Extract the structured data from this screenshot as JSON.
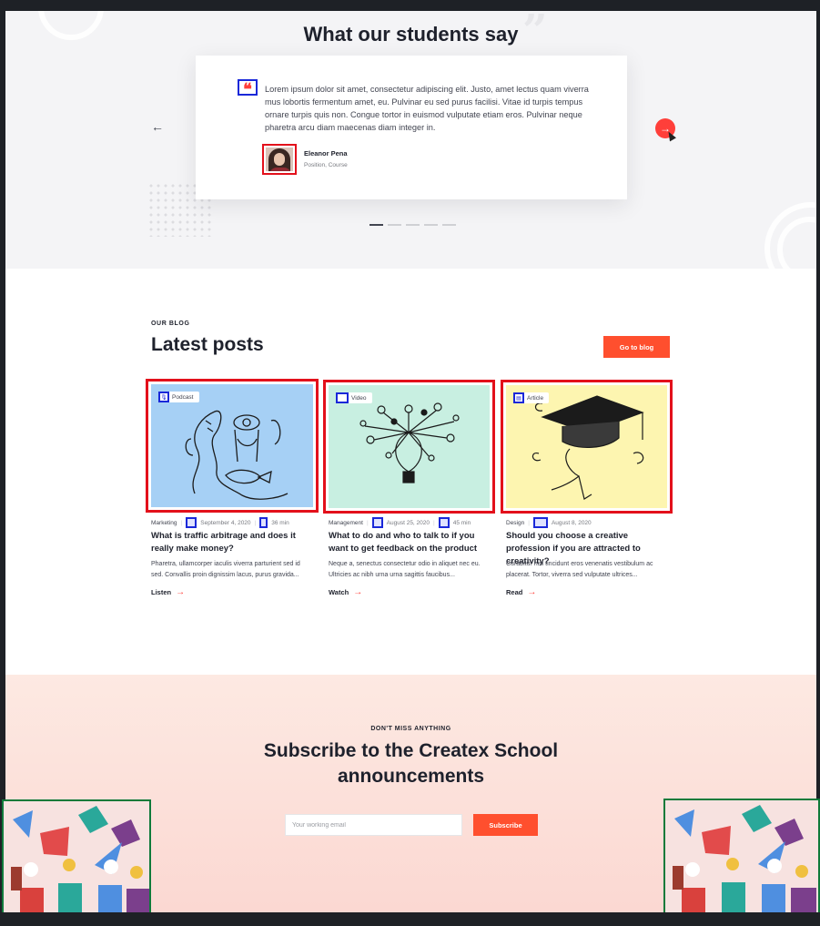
{
  "testimonials": {
    "title": "What our students say",
    "quote": "Lorem ipsum dolor sit amet, consectetur adipiscing elit. Justo, amet lectus quam viverra mus lobortis fermentum amet, eu. Pulvinar eu sed purus facilisi. Vitae id turpis tempus ornare turpis quis non. Congue tortor in euismod vulputate etiam eros. Pulvinar neque pharetra arcu diam maecenas diam integer in.",
    "author": "Eleanor Pena",
    "position": "Position, Course",
    "prev_arrow": "←",
    "next_arrow": "→",
    "pager_count": 5,
    "active_page": 1
  },
  "blog": {
    "eyebrow": "OUR BLOG",
    "title": "Latest posts",
    "cta": "Go to blog",
    "posts": [
      {
        "badge": "Podcast",
        "category": "Marketing",
        "date": "September 4, 2020",
        "duration": "36 min",
        "title": "What is traffic arbitrage and does it really make money?",
        "excerpt": "Pharetra, ullamcorper iaculis viverra parturient sed id sed. Convallis proin dignissim lacus, purus gravida...",
        "link": "Listen",
        "image_bg": "#a6d0f5"
      },
      {
        "badge": "Video",
        "category": "Management",
        "date": "August 25, 2020",
        "duration": "45 min",
        "title": "What to do and who to talk to if you want to get feedback on the product",
        "excerpt": "Neque a, senectus consectetur odio in aliquet nec eu. Ultricies ac nibh urna urna sagittis faucibus...",
        "link": "Watch",
        "image_bg": "#c8efe1"
      },
      {
        "badge": "Article",
        "category": "Design",
        "date": "August 8, 2020",
        "duration": "",
        "title": "Should you choose a creative profession if you are attracted to creativity?",
        "excerpt": "Curabitur nisi tincidunt eros venenatis vestibulum ac placerat. Tortor, viverra sed vulputate ultrices...",
        "link": "Read",
        "image_bg": "#fdf5b0"
      }
    ]
  },
  "subscribe": {
    "eyebrow": "DON'T MISS ANYTHING",
    "title": "Subscribe to the Createx School announcements",
    "email_placeholder": "Your working email",
    "button": "Subscribe"
  },
  "colors": {
    "accent": "#ff4f2e",
    "dark": "#1e212c",
    "annotation_blue": "#1a28d9",
    "annotation_red": "#e3101b",
    "annotation_green": "#0f7a3a"
  }
}
